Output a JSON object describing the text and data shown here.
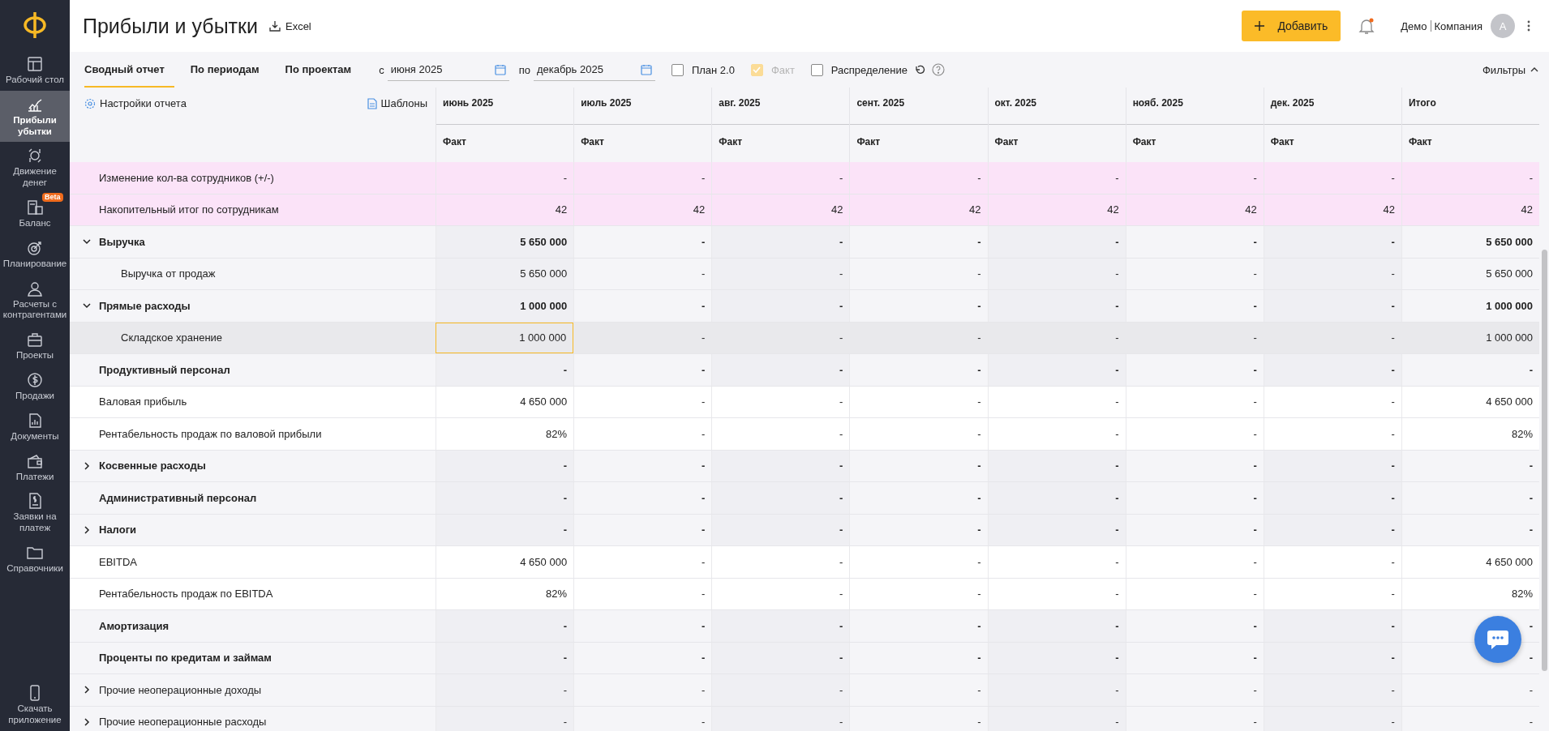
{
  "sidebar": {
    "items": [
      {
        "label": "Рабочий стол",
        "selected": false
      },
      {
        "label": "Прибыли убытки",
        "selected": true
      },
      {
        "label": "Движение денег",
        "selected": false
      },
      {
        "label": "Баланс",
        "selected": false,
        "badge": "Beta"
      },
      {
        "label": "Планирование",
        "selected": false
      },
      {
        "label": "Расчеты с контрагентами",
        "selected": false
      },
      {
        "label": "Проекты",
        "selected": false
      },
      {
        "label": "Продажи",
        "selected": false
      },
      {
        "label": "Документы",
        "selected": false
      },
      {
        "label": "Платежи",
        "selected": false
      },
      {
        "label": "Заявки на платеж",
        "selected": false
      },
      {
        "label": "Справочники",
        "selected": false
      }
    ],
    "footer": "Скачать приложение"
  },
  "header": {
    "title": "Прибыли и убытки",
    "export": "Excel",
    "add_button": "Добавить",
    "notification": true,
    "user": "Демо",
    "company": "Компания",
    "avatar": "А"
  },
  "toolbar": {
    "tabs": [
      {
        "label": "Сводный отчет",
        "selected": true
      },
      {
        "label": "По периодам",
        "selected": false
      },
      {
        "label": "По проектам",
        "selected": false
      }
    ],
    "from_label": "с",
    "from_value": "июня 2025",
    "to_label": "по",
    "to_value": "декабрь 2025",
    "checkboxes": [
      {
        "label": "План 2.0",
        "checked": false,
        "disabled": false
      },
      {
        "label": "Факт",
        "checked": true,
        "disabled": true
      },
      {
        "label": "Распределение",
        "checked": false,
        "disabled": false
      }
    ],
    "filters": {
      "label": "Фильтры",
      "expanded": true
    }
  },
  "table": {
    "settings": "Настройки отчета",
    "templates": "Шаблоны",
    "columns": [
      {
        "title": "июнь 2025",
        "sub": "Факт"
      },
      {
        "title": "июль 2025",
        "sub": "Факт"
      },
      {
        "title": "авг. 2025",
        "sub": "Факт"
      },
      {
        "title": "сент. 2025",
        "sub": "Факт"
      },
      {
        "title": "окт. 2025",
        "sub": "Факт"
      },
      {
        "title": "нояб. 2025",
        "sub": "Факт"
      },
      {
        "title": "дек. 2025",
        "sub": "Факт"
      },
      {
        "title": "Итого",
        "sub": "Факт"
      }
    ],
    "rows": [
      {
        "label": "Изменение кол-ва сотрудников (+/-)",
        "kind": "metric",
        "selected": false,
        "values": [
          "-",
          "-",
          "-",
          "-",
          "-",
          "-",
          "-",
          "-"
        ]
      },
      {
        "label": "Накопительный итог по сотрудникам",
        "kind": "metric",
        "selected": false,
        "values": [
          "42",
          "42",
          "42",
          "42",
          "42",
          "42",
          "42",
          "42"
        ]
      },
      {
        "label": "Выручка",
        "kind": "group",
        "expanded": true,
        "selected": false,
        "values": [
          "5 650 000",
          "-",
          "-",
          "-",
          "-",
          "-",
          "-",
          "5 650 000"
        ]
      },
      {
        "label": "Выручка от продаж",
        "kind": "item",
        "selected": false,
        "values": [
          "5 650 000",
          "-",
          "-",
          "-",
          "-",
          "-",
          "-",
          "5 650 000"
        ]
      },
      {
        "label": "Прямые расходы",
        "kind": "group",
        "expanded": true,
        "selected": false,
        "values": [
          "1 000 000",
          "-",
          "-",
          "-",
          "-",
          "-",
          "-",
          "1 000 000"
        ]
      },
      {
        "label": "Складское хранение",
        "kind": "item",
        "selected": true,
        "values": [
          "1 000 000",
          "-",
          "-",
          "-",
          "-",
          "-",
          "-",
          "1 000 000"
        ]
      },
      {
        "label": "Продуктивный персонал",
        "kind": "group",
        "selected": false,
        "values": [
          "-",
          "-",
          "-",
          "-",
          "-",
          "-",
          "-",
          "-"
        ]
      },
      {
        "label": "Валовая прибыль",
        "kind": "plain",
        "selected": false,
        "values": [
          "4 650 000",
          "-",
          "-",
          "-",
          "-",
          "-",
          "-",
          "4 650 000"
        ]
      },
      {
        "label": "Рентабельность продаж по валовой прибыли",
        "kind": "plain",
        "selected": false,
        "values": [
          "82%",
          "-",
          "-",
          "-",
          "-",
          "-",
          "-",
          "82%"
        ]
      },
      {
        "label": "Косвенные расходы",
        "kind": "group",
        "expanded": false,
        "selected": false,
        "values": [
          "-",
          "-",
          "-",
          "-",
          "-",
          "-",
          "-",
          "-"
        ]
      },
      {
        "label": "Административный персонал",
        "kind": "group",
        "selected": false,
        "values": [
          "-",
          "-",
          "-",
          "-",
          "-",
          "-",
          "-",
          "-"
        ]
      },
      {
        "label": "Налоги",
        "kind": "group",
        "expanded": false,
        "selected": false,
        "values": [
          "-",
          "-",
          "-",
          "-",
          "-",
          "-",
          "-",
          "-"
        ]
      },
      {
        "label": "EBITDA",
        "kind": "plain",
        "selected": false,
        "values": [
          "4 650 000",
          "-",
          "-",
          "-",
          "-",
          "-",
          "-",
          "4 650 000"
        ]
      },
      {
        "label": "Рентабельность продаж по EBITDA",
        "kind": "plain",
        "selected": false,
        "values": [
          "82%",
          "-",
          "-",
          "-",
          "-",
          "-",
          "-",
          "82%"
        ]
      },
      {
        "label": "Амортизация",
        "kind": "group",
        "selected": false,
        "values": [
          "-",
          "-",
          "-",
          "-",
          "-",
          "-",
          "-",
          "-"
        ]
      },
      {
        "label": "Проценты по кредитам и займам",
        "kind": "group",
        "selected": false,
        "values": [
          "-",
          "-",
          "-",
          "-",
          "-",
          "-",
          "-",
          "-"
        ]
      },
      {
        "label": "Прочие неоперационные доходы",
        "kind": "section",
        "expanded": false,
        "selected": false,
        "values": [
          "-",
          "-",
          "-",
          "-",
          "-",
          "-",
          "-",
          "-"
        ]
      },
      {
        "label": "Прочие неоперационные расходы",
        "kind": "section",
        "expanded": false,
        "selected": false,
        "values": [
          "-",
          "-",
          "-",
          "-",
          "-",
          "-",
          "-",
          "-"
        ]
      }
    ]
  }
}
